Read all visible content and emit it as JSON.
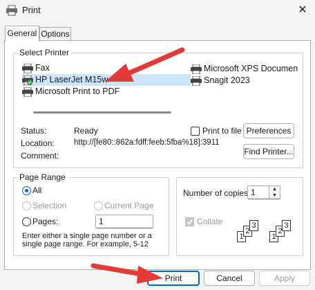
{
  "window": {
    "title": "Print",
    "close_glyph": "✕"
  },
  "tabs": [
    {
      "label": "General",
      "active": true
    },
    {
      "label": "Options",
      "active": false
    }
  ],
  "select_printer": {
    "label": "Select Printer",
    "printers": [
      {
        "name": "Fax",
        "status_icon": "none"
      },
      {
        "name": "HP LaserJet M15w",
        "status_icon": "default-check",
        "selected": true
      },
      {
        "name": "Microsoft Print to PDF",
        "status_icon": "none"
      },
      {
        "name": "Microsoft XPS Documen",
        "status_icon": "none"
      },
      {
        "name": "Snagit 2023",
        "status_icon": "none"
      }
    ],
    "status_label": "Status:",
    "status_value": "Ready",
    "location_label": "Location:",
    "location_value": "http://[fe80::862a:fdff:feeb:5fba%18]:3911",
    "comment_label": "Comment:",
    "comment_value": "",
    "print_to_file_label": "Print to file",
    "print_to_file_checked": false,
    "preferences_label": "Preferences",
    "find_printer_label": "Find Printer..."
  },
  "page_range": {
    "label": "Page Range",
    "all_label": "All",
    "selection_label": "Selection",
    "current_page_label": "Current Page",
    "pages_label": "Pages:",
    "pages_value": "1",
    "selected_option": "All",
    "hint": "Enter either a single page number or a single page range.  For example, 5-12"
  },
  "copies": {
    "label": "Number of copies:",
    "value": "1",
    "collate_label": "Collate",
    "collate_checked": true,
    "collate_disabled": true,
    "collate_pages": [
      "1",
      "2",
      "3"
    ]
  },
  "footer": {
    "print_label": "Print",
    "cancel_label": "Cancel",
    "apply_label": "Apply"
  },
  "colors": {
    "accent": "#0067c0",
    "selection": "#cce4f7",
    "arrow": "#e53935",
    "dialog_bg": "#f3f3f3"
  }
}
